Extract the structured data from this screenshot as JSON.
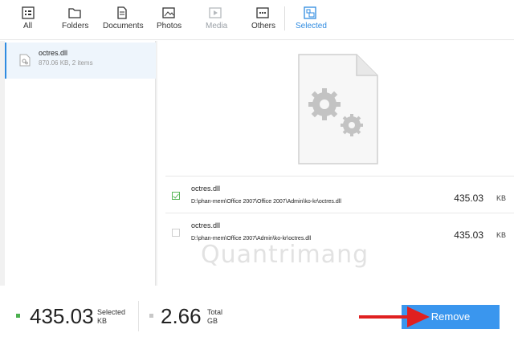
{
  "toolbar": {
    "tabs": [
      {
        "label": "All",
        "icon": "all-icon"
      },
      {
        "label": "Folders",
        "icon": "folder-icon"
      },
      {
        "label": "Documents",
        "icon": "document-icon"
      },
      {
        "label": "Photos",
        "icon": "photo-icon"
      },
      {
        "label": "Media",
        "icon": "media-icon"
      },
      {
        "label": "Others",
        "icon": "others-icon"
      },
      {
        "label": "Selected",
        "icon": "selected-icon"
      }
    ]
  },
  "sidebar": {
    "file": {
      "name": "octres.dll",
      "meta": "870.06 KB, 2 items"
    }
  },
  "items": [
    {
      "name": "octres.dll",
      "path": "D:\\phan-mem\\Office 2007\\Office 2007\\Admin\\ko-kr\\octres.dll",
      "size": "435.03",
      "unit": "KB",
      "checked": true
    },
    {
      "name": "octres.dll",
      "path": "D:\\phan-mem\\Office 2007\\Admin\\ko-kr\\octres.dll",
      "size": "435.03",
      "unit": "KB",
      "checked": false
    }
  ],
  "footer": {
    "selected_value": "435.03",
    "selected_label": "Selected",
    "selected_unit": "KB",
    "total_value": "2.66",
    "total_label": "Total",
    "total_unit": "GB",
    "remove_label": "Remove"
  },
  "watermark": "Quantrimang",
  "colors": {
    "accent": "#3a96ee",
    "selected_dot": "#4cb04f",
    "arrow": "#e02020"
  }
}
